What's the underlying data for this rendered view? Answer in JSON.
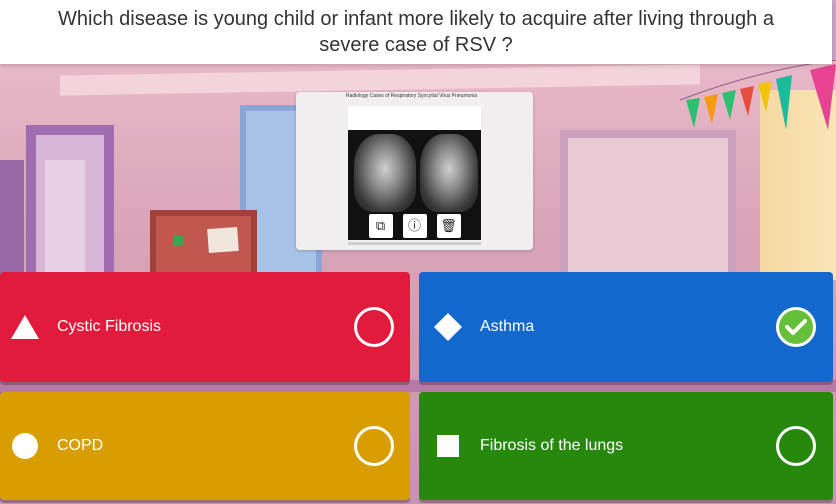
{
  "question": {
    "text": "Which disease is young child or infant more likely to acquire after living through a severe case of RSV ?"
  },
  "image": {
    "caption": "Radiology Cases of Respiratory Syncytial Virus Pneumonia",
    "toolbar": [
      {
        "icon": "crop-icon",
        "glyph": "⧉"
      },
      {
        "icon": "info-icon",
        "glyph": "ⓘ"
      },
      {
        "icon": "trash-icon",
        "glyph": "🗑"
      }
    ]
  },
  "answers": [
    {
      "label": "Cystic Fibrosis",
      "shape": "triangle",
      "color": "#e21b3c",
      "selected": false
    },
    {
      "label": "Asthma",
      "shape": "diamond",
      "color": "#1368ce",
      "selected": true
    },
    {
      "label": "COPD",
      "shape": "circle",
      "color": "#d89e00",
      "selected": false
    },
    {
      "label": "Fibrosis of the lungs",
      "shape": "square",
      "color": "#26890c",
      "selected": false
    }
  ],
  "colors": {
    "check": "#66bf39"
  }
}
